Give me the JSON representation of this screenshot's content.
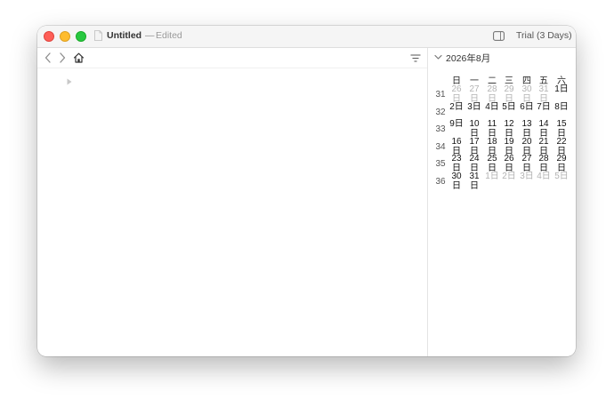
{
  "window": {
    "title": "Untitled",
    "title_separator": "—",
    "status": "Edited",
    "trial_label": "Trial (3 Days)"
  },
  "toolbar": {
    "back_icon": "chevron-left-icon",
    "forward_icon": "chevron-right-icon",
    "home_icon": "house-icon",
    "filter_icon": "filter-lines-icon"
  },
  "calendar": {
    "month_label": "2026年8月",
    "weekdays": [
      "日",
      "一",
      "二",
      "三",
      "四",
      "五",
      "六"
    ],
    "weeks": [
      {
        "number": "31",
        "days": [
          {
            "text": "26日",
            "other": true
          },
          {
            "text": "27日",
            "other": true
          },
          {
            "text": "28日",
            "other": true
          },
          {
            "text": "29日",
            "other": true
          },
          {
            "text": "30日",
            "other": true
          },
          {
            "text": "31日",
            "other": true
          },
          {
            "text": "1日",
            "other": false
          }
        ]
      },
      {
        "number": "32",
        "days": [
          {
            "text": "2日",
            "other": false
          },
          {
            "text": "3日",
            "other": false
          },
          {
            "text": "4日",
            "other": false
          },
          {
            "text": "5日",
            "other": false
          },
          {
            "text": "6日",
            "other": false
          },
          {
            "text": "7日",
            "other": false
          },
          {
            "text": "8日",
            "other": false
          }
        ]
      },
      {
        "number": "33",
        "days": [
          {
            "text": "9日",
            "other": false
          },
          {
            "text": "10日",
            "other": false
          },
          {
            "text": "11日",
            "other": false
          },
          {
            "text": "12日",
            "other": false
          },
          {
            "text": "13日",
            "other": false
          },
          {
            "text": "14日",
            "other": false
          },
          {
            "text": "15日",
            "other": false
          }
        ]
      },
      {
        "number": "34",
        "days": [
          {
            "text": "16日",
            "other": false
          },
          {
            "text": "17日",
            "other": false
          },
          {
            "text": "18日",
            "other": false
          },
          {
            "text": "19日",
            "other": false
          },
          {
            "text": "20日",
            "other": false
          },
          {
            "text": "21日",
            "other": false
          },
          {
            "text": "22日",
            "other": false
          }
        ]
      },
      {
        "number": "35",
        "days": [
          {
            "text": "23日",
            "other": false
          },
          {
            "text": "24日",
            "other": false
          },
          {
            "text": "25日",
            "other": false
          },
          {
            "text": "26日",
            "other": false
          },
          {
            "text": "27日",
            "other": false
          },
          {
            "text": "28日",
            "other": false
          },
          {
            "text": "29日",
            "other": false
          }
        ]
      },
      {
        "number": "36",
        "days": [
          {
            "text": "30日",
            "other": false
          },
          {
            "text": "31日",
            "other": false
          },
          {
            "text": "1日",
            "other": true
          },
          {
            "text": "2日",
            "other": true
          },
          {
            "text": "3日",
            "other": true
          },
          {
            "text": "4日",
            "other": true
          },
          {
            "text": "5日",
            "other": true
          }
        ]
      }
    ]
  },
  "colors": {
    "close": "#fe5f57",
    "minimize": "#febc2e",
    "maximize": "#28c840",
    "other_month_day": "#b3b3b3"
  }
}
